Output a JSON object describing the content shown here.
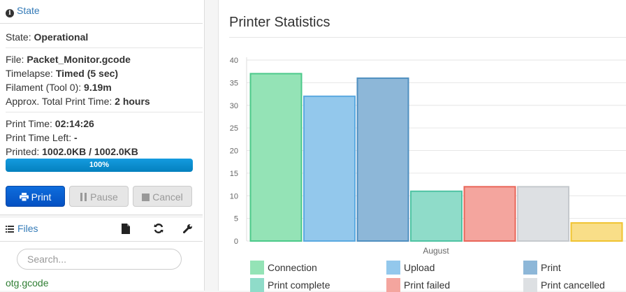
{
  "state": {
    "title": "State",
    "state_label": "State: ",
    "state_value": "Operational",
    "file_label": "File: ",
    "file_value": "Packet_Monitor.gcode",
    "timelapse_label": "Timelapse: ",
    "timelapse_value": "Timed (5 sec)",
    "filament_label": "Filament (Tool 0): ",
    "filament_value": "9.19m",
    "approx_label": "Approx. Total Print Time: ",
    "approx_value": "2 hours",
    "print_time_label": "Print Time: ",
    "print_time_value": "02:14:26",
    "time_left_label": "Print Time Left: ",
    "time_left_value": "-",
    "printed_label": "Printed: ",
    "printed_value": "1002.0KB / 1002.0KB",
    "progress_text": "100%",
    "progress": 1.0
  },
  "buttons": {
    "print": "Print",
    "pause": "Pause",
    "cancel": "Cancel"
  },
  "files": {
    "title": "Files",
    "search_placeholder": "Search...",
    "items": [
      "otg.gcode"
    ]
  },
  "main": {
    "title": "Printer Statistics"
  },
  "chart_data": {
    "type": "bar",
    "categories": [
      "August"
    ],
    "series": [
      {
        "name": "Connection",
        "values": [
          37
        ],
        "fill": "#94e3b6",
        "stroke": "#4cc98a"
      },
      {
        "name": "Upload",
        "values": [
          32
        ],
        "fill": "#93c8ec",
        "stroke": "#5aa9e0"
      },
      {
        "name": "Print",
        "values": [
          36
        ],
        "fill": "#8db7d8",
        "stroke": "#4f8fc0"
      },
      {
        "name": "Print complete",
        "values": [
          11
        ],
        "fill": "#8fdcc9",
        "stroke": "#4fc3a3"
      },
      {
        "name": "Print failed",
        "values": [
          12
        ],
        "fill": "#f4a59e",
        "stroke": "#e9665a"
      },
      {
        "name": "Print cancelled",
        "values": [
          12
        ],
        "fill": "#dde0e3",
        "stroke": "#c5c9cd"
      },
      {
        "name": "",
        "values": [
          4
        ],
        "fill": "#f9de88",
        "stroke": "#f0c330"
      }
    ],
    "yticks": [
      0,
      5,
      10,
      15,
      20,
      25,
      30,
      35,
      40
    ],
    "ylim": [
      0,
      40
    ],
    "grid": true
  }
}
